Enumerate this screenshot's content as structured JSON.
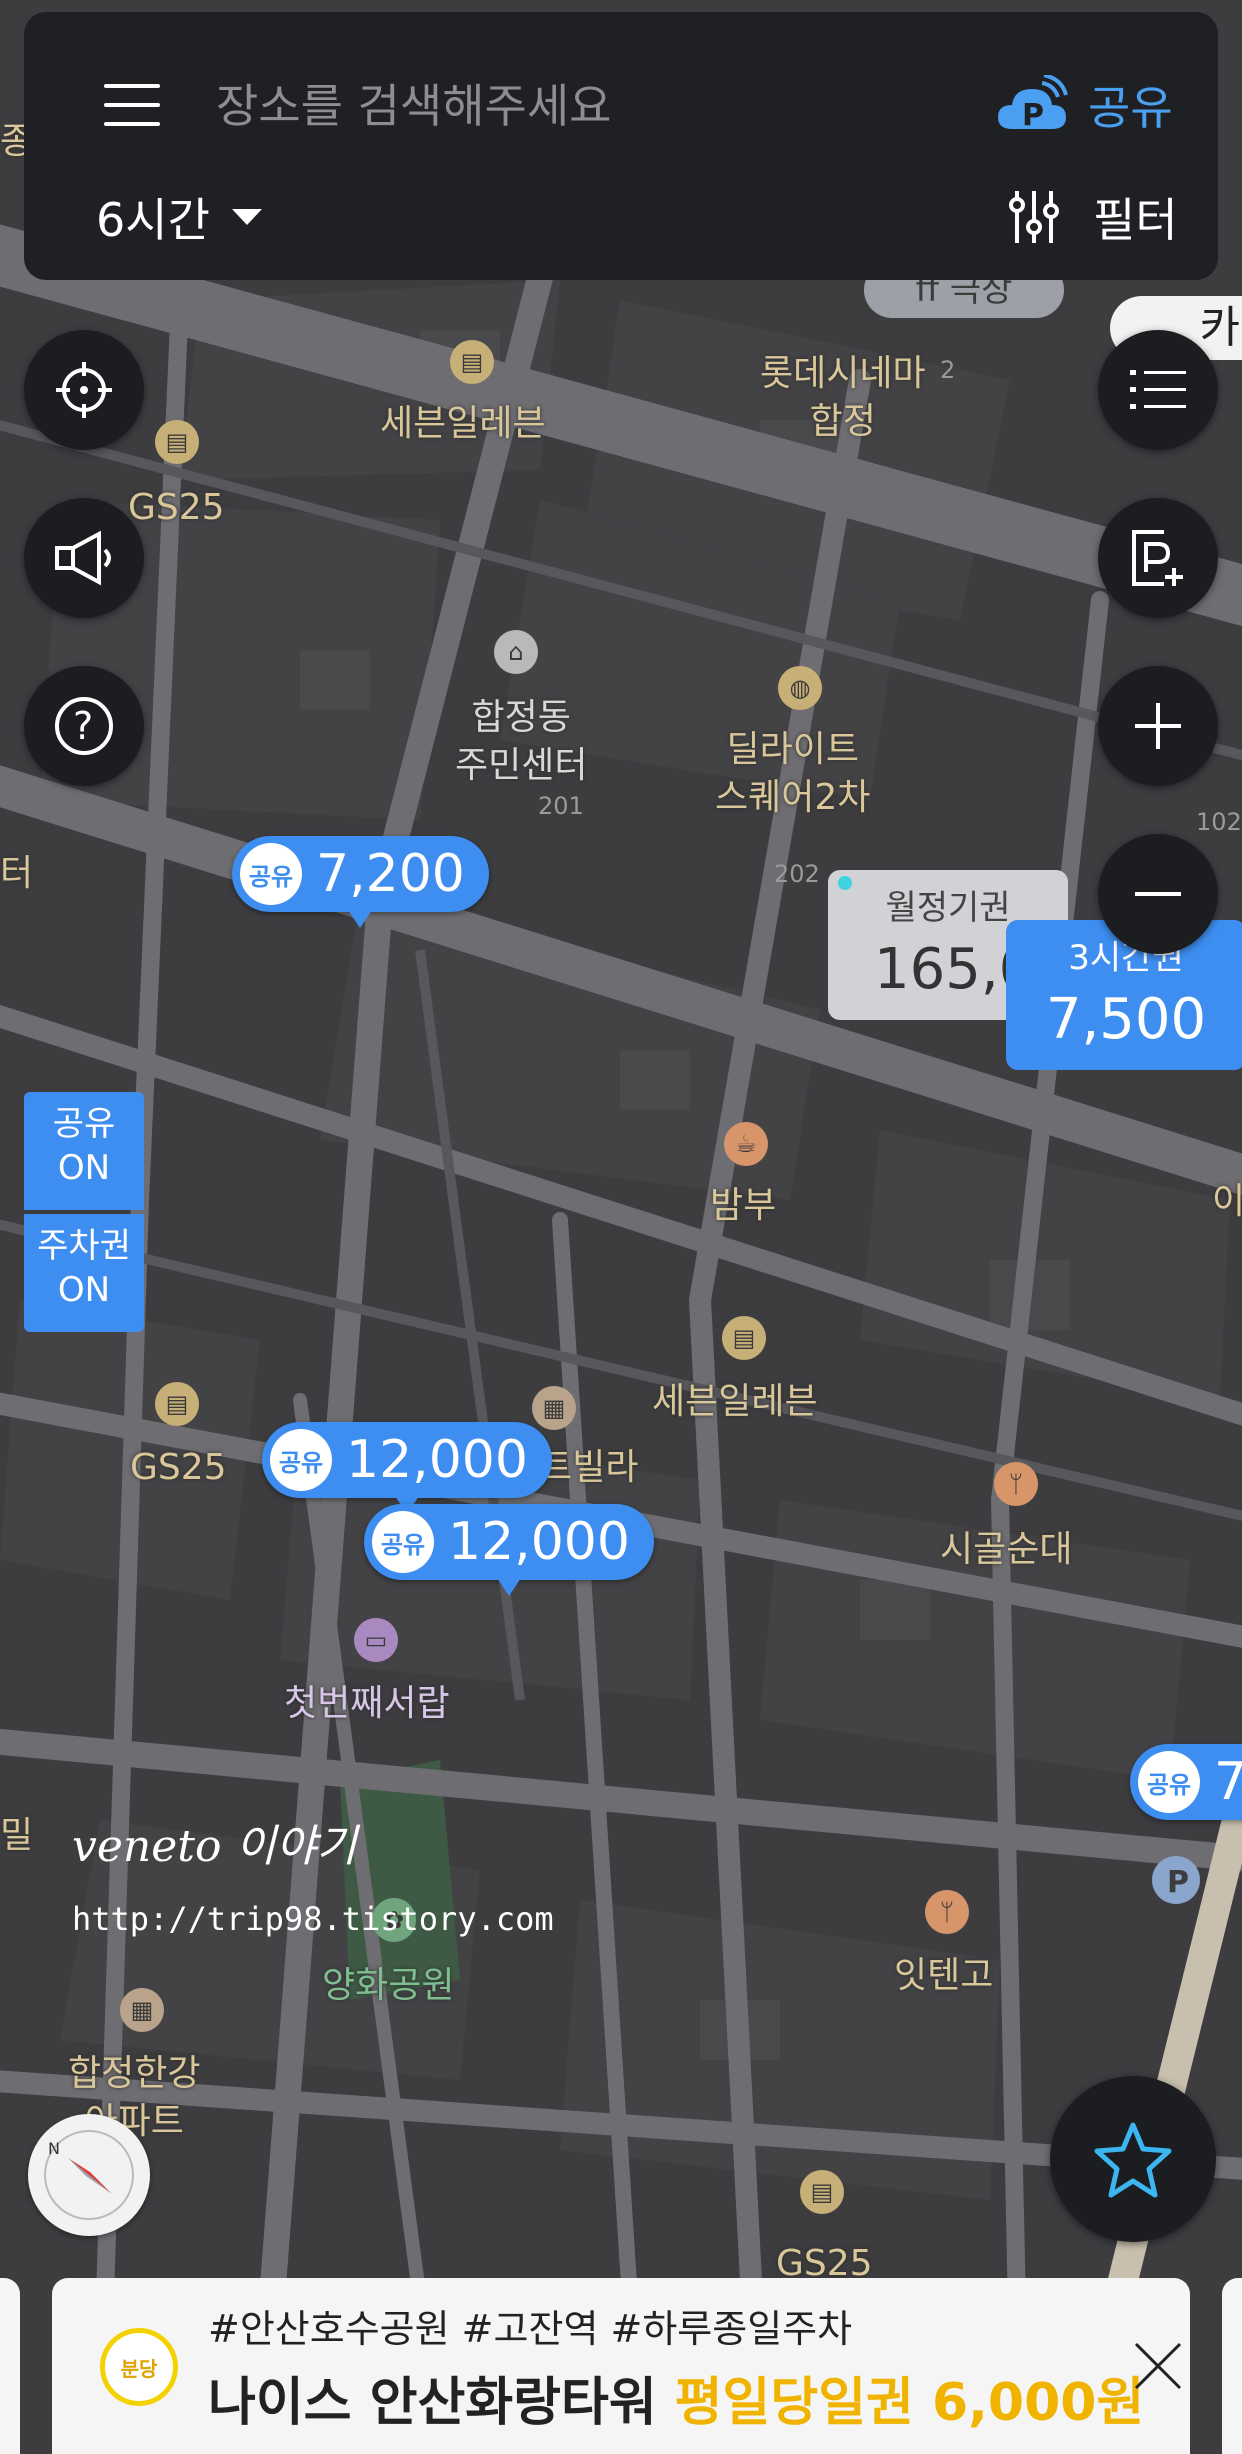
{
  "search": {
    "placeholder": "장소를 검색해주세요"
  },
  "topbar": {
    "share_label": "공유",
    "time_label": "6시간",
    "filter_label": "필터"
  },
  "icons": {
    "menu": "hamburger-menu-icon",
    "share": "cloud-parking-icon",
    "filter": "sliders-icon",
    "locate": "crosshair-icon",
    "megaphone": "megaphone-icon",
    "help": "question-icon",
    "list": "list-icon",
    "add_parking": "parking-plus-icon",
    "zoom_in": "plus-icon",
    "zoom_out": "minus-icon",
    "favorite": "star-icon",
    "compass": "compass-icon",
    "close": "close-icon"
  },
  "colors": {
    "accent": "#3d8ef0",
    "bar": "#1f2024",
    "map": "#3d3d40",
    "road": "#6e6e72",
    "ad_offer": "#f0b400"
  },
  "toggles": {
    "share": {
      "line1": "공유",
      "line2": "ON"
    },
    "ticket": {
      "line1": "주차권",
      "line2": "ON"
    }
  },
  "markers": {
    "share_badge": "공유",
    "m1": "7,200",
    "m2": "12,000",
    "m3": "12,000",
    "m4": "7",
    "monthly": {
      "title": "월정기권",
      "value": "165,0"
    },
    "three_hour": {
      "title": "3시간권",
      "value": "7,500"
    },
    "top_partial": "ff 극장",
    "top_right_partial": "카"
  },
  "pois": {
    "seven1": "세븐일레븐",
    "gs25a": "GS25",
    "lotte": "롯데시네마\n합정",
    "center": "합정동\n주민센터",
    "delight": "딜라이트\n스퀘어2차",
    "bambu": "밤부",
    "seven2": "세븐일레븐",
    "gs25b": "GS25",
    "villa": "아트빌라",
    "sigol": "시골순대",
    "firstroom": "첫번째서랍",
    "yanghwa": "양화공원",
    "itengo": "잇텐고",
    "hapjeong_apt": "합정한강\n아파트",
    "gs25c": "GS25",
    "left_partial_1": "종",
    "left_partial_2": "터",
    "left_partial_3": "밀",
    "right_partial": "이"
  },
  "numbers": {
    "n201": "201",
    "n202": "202",
    "n102": "102",
    "n2": "2"
  },
  "watermark": {
    "title": "veneto 이야기",
    "url": "http://trip98.tistory.com"
  },
  "ad": {
    "logo": "분당",
    "tags": "#안산호수공원 #고잔역 #하루종일주차",
    "name": "나이스 안산화랑타워",
    "offer": "평일당일권 6,000원"
  }
}
